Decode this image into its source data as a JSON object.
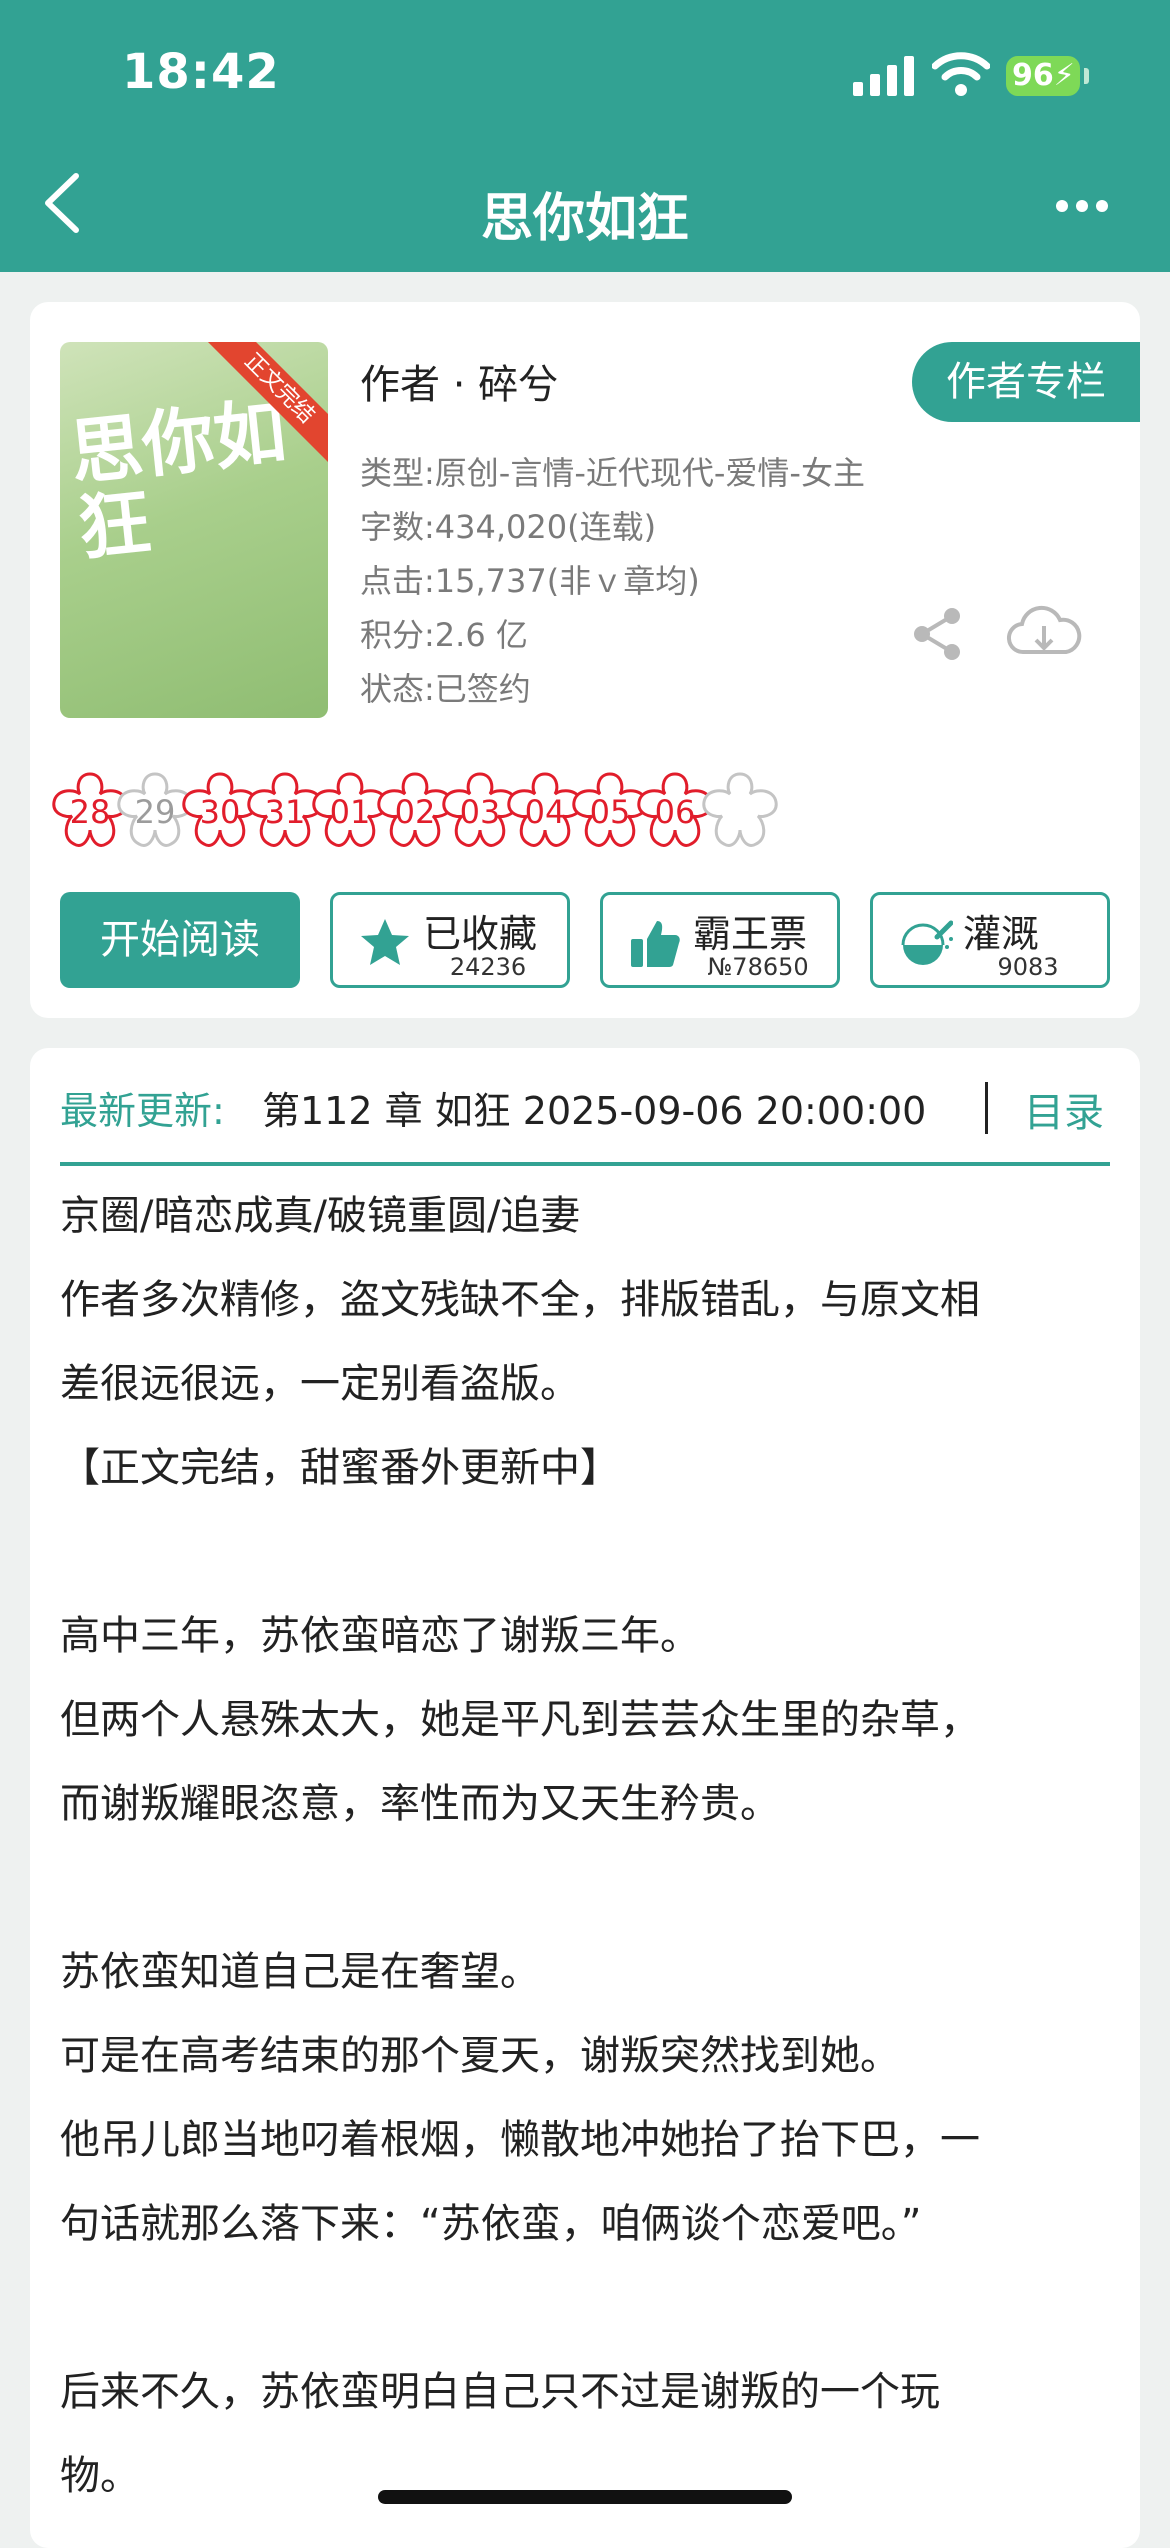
{
  "status_bar": {
    "time": "18:42",
    "battery": "96"
  },
  "nav": {
    "title": "思你如狂"
  },
  "book": {
    "cover_title": "思你如狂",
    "cover_ribbon": "正文完结",
    "author": "作者 · 碎兮",
    "author_column_button": "作者专栏",
    "genre": "类型:原创-言情-近代现代-爱情-女主",
    "word_count": "字数:434,020(连载)",
    "clicks": "点击:15,737(非ｖ章均)",
    "score": "积分:2.6 亿",
    "status": "状态:已签约"
  },
  "flowers": [
    {
      "label": "28",
      "active": true
    },
    {
      "label": "29",
      "active": false
    },
    {
      "label": "30",
      "active": true
    },
    {
      "label": "31",
      "active": true
    },
    {
      "label": "01",
      "active": true
    },
    {
      "label": "02",
      "active": true
    },
    {
      "label": "03",
      "active": true
    },
    {
      "label": "04",
      "active": true
    },
    {
      "label": "05",
      "active": true
    },
    {
      "label": "06",
      "active": true
    }
  ],
  "actions": {
    "read_label": "开始阅读",
    "collect_label": "已收藏",
    "collect_count": "24236",
    "ticket_label": "霸王票",
    "ticket_count": "№78650",
    "water_label": "灌溉",
    "water_count": "9083"
  },
  "update": {
    "label": "最新更新:",
    "text": "第112 章 如狂 2025-09-06 20:00:00",
    "catalog": "目录"
  },
  "description": [
    "京圈/暗恋成真/破镜重圆/追妻",
    "作者多次精修，盗文残缺不全，排版错乱，与原文相",
    "差很远很远，一定别看盗版。",
    "【正文完结，甜蜜番外更新中】",
    "",
    "高中三年，苏依蛮暗恋了谢叛三年。",
    "但两个人悬殊太大，她是平凡到芸芸众生里的杂草，",
    "而谢叛耀眼恣意，率性而为又天生矜贵。",
    "",
    "苏依蛮知道自己是在奢望。",
    "可是在高考结束的那个夏天，谢叛突然找到她。",
    "他吊儿郎当地叼着根烟，懒散地冲她抬了抬下巴，一",
    "句话就那么落下来：“苏依蛮，咱俩谈个恋爱吧。”",
    "",
    "后来不久，苏依蛮明白自己只不过是谢叛的一个玩",
    "物。"
  ],
  "colors": {
    "accent": "#32a293",
    "flower_red": "#e11d2b"
  },
  "icons": [
    "back-chevron-icon",
    "more-dots-icon",
    "share-icon",
    "download-cloud-icon",
    "star-icon",
    "thumbs-up-icon",
    "watering-can-icon"
  ]
}
